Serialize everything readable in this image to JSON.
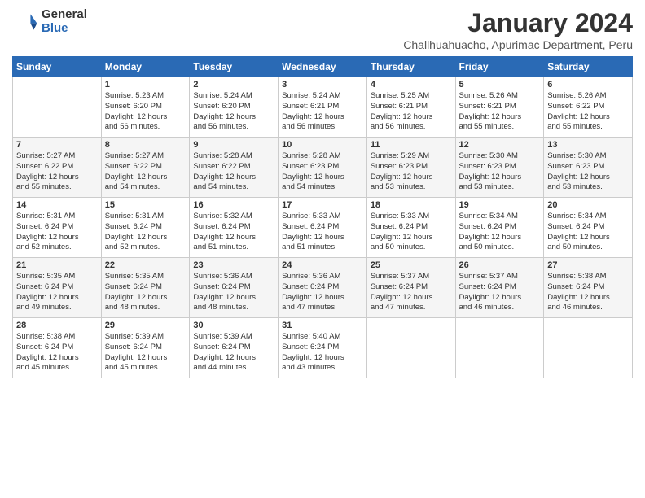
{
  "logo": {
    "general": "General",
    "blue": "Blue"
  },
  "title": "January 2024",
  "subtitle": "Challhuahuacho, Apurimac Department, Peru",
  "headers": [
    "Sunday",
    "Monday",
    "Tuesday",
    "Wednesday",
    "Thursday",
    "Friday",
    "Saturday"
  ],
  "weeks": [
    [
      {
        "num": "",
        "info": ""
      },
      {
        "num": "1",
        "info": "Sunrise: 5:23 AM\nSunset: 6:20 PM\nDaylight: 12 hours\nand 56 minutes."
      },
      {
        "num": "2",
        "info": "Sunrise: 5:24 AM\nSunset: 6:20 PM\nDaylight: 12 hours\nand 56 minutes."
      },
      {
        "num": "3",
        "info": "Sunrise: 5:24 AM\nSunset: 6:21 PM\nDaylight: 12 hours\nand 56 minutes."
      },
      {
        "num": "4",
        "info": "Sunrise: 5:25 AM\nSunset: 6:21 PM\nDaylight: 12 hours\nand 56 minutes."
      },
      {
        "num": "5",
        "info": "Sunrise: 5:26 AM\nSunset: 6:21 PM\nDaylight: 12 hours\nand 55 minutes."
      },
      {
        "num": "6",
        "info": "Sunrise: 5:26 AM\nSunset: 6:22 PM\nDaylight: 12 hours\nand 55 minutes."
      }
    ],
    [
      {
        "num": "7",
        "info": "Sunrise: 5:27 AM\nSunset: 6:22 PM\nDaylight: 12 hours\nand 55 minutes."
      },
      {
        "num": "8",
        "info": "Sunrise: 5:27 AM\nSunset: 6:22 PM\nDaylight: 12 hours\nand 54 minutes."
      },
      {
        "num": "9",
        "info": "Sunrise: 5:28 AM\nSunset: 6:22 PM\nDaylight: 12 hours\nand 54 minutes."
      },
      {
        "num": "10",
        "info": "Sunrise: 5:28 AM\nSunset: 6:23 PM\nDaylight: 12 hours\nand 54 minutes."
      },
      {
        "num": "11",
        "info": "Sunrise: 5:29 AM\nSunset: 6:23 PM\nDaylight: 12 hours\nand 53 minutes."
      },
      {
        "num": "12",
        "info": "Sunrise: 5:30 AM\nSunset: 6:23 PM\nDaylight: 12 hours\nand 53 minutes."
      },
      {
        "num": "13",
        "info": "Sunrise: 5:30 AM\nSunset: 6:23 PM\nDaylight: 12 hours\nand 53 minutes."
      }
    ],
    [
      {
        "num": "14",
        "info": "Sunrise: 5:31 AM\nSunset: 6:24 PM\nDaylight: 12 hours\nand 52 minutes."
      },
      {
        "num": "15",
        "info": "Sunrise: 5:31 AM\nSunset: 6:24 PM\nDaylight: 12 hours\nand 52 minutes."
      },
      {
        "num": "16",
        "info": "Sunrise: 5:32 AM\nSunset: 6:24 PM\nDaylight: 12 hours\nand 51 minutes."
      },
      {
        "num": "17",
        "info": "Sunrise: 5:33 AM\nSunset: 6:24 PM\nDaylight: 12 hours\nand 51 minutes."
      },
      {
        "num": "18",
        "info": "Sunrise: 5:33 AM\nSunset: 6:24 PM\nDaylight: 12 hours\nand 50 minutes."
      },
      {
        "num": "19",
        "info": "Sunrise: 5:34 AM\nSunset: 6:24 PM\nDaylight: 12 hours\nand 50 minutes."
      },
      {
        "num": "20",
        "info": "Sunrise: 5:34 AM\nSunset: 6:24 PM\nDaylight: 12 hours\nand 50 minutes."
      }
    ],
    [
      {
        "num": "21",
        "info": "Sunrise: 5:35 AM\nSunset: 6:24 PM\nDaylight: 12 hours\nand 49 minutes."
      },
      {
        "num": "22",
        "info": "Sunrise: 5:35 AM\nSunset: 6:24 PM\nDaylight: 12 hours\nand 48 minutes."
      },
      {
        "num": "23",
        "info": "Sunrise: 5:36 AM\nSunset: 6:24 PM\nDaylight: 12 hours\nand 48 minutes."
      },
      {
        "num": "24",
        "info": "Sunrise: 5:36 AM\nSunset: 6:24 PM\nDaylight: 12 hours\nand 47 minutes."
      },
      {
        "num": "25",
        "info": "Sunrise: 5:37 AM\nSunset: 6:24 PM\nDaylight: 12 hours\nand 47 minutes."
      },
      {
        "num": "26",
        "info": "Sunrise: 5:37 AM\nSunset: 6:24 PM\nDaylight: 12 hours\nand 46 minutes."
      },
      {
        "num": "27",
        "info": "Sunrise: 5:38 AM\nSunset: 6:24 PM\nDaylight: 12 hours\nand 46 minutes."
      }
    ],
    [
      {
        "num": "28",
        "info": "Sunrise: 5:38 AM\nSunset: 6:24 PM\nDaylight: 12 hours\nand 45 minutes."
      },
      {
        "num": "29",
        "info": "Sunrise: 5:39 AM\nSunset: 6:24 PM\nDaylight: 12 hours\nand 45 minutes."
      },
      {
        "num": "30",
        "info": "Sunrise: 5:39 AM\nSunset: 6:24 PM\nDaylight: 12 hours\nand 44 minutes."
      },
      {
        "num": "31",
        "info": "Sunrise: 5:40 AM\nSunset: 6:24 PM\nDaylight: 12 hours\nand 43 minutes."
      },
      {
        "num": "",
        "info": ""
      },
      {
        "num": "",
        "info": ""
      },
      {
        "num": "",
        "info": ""
      }
    ]
  ]
}
